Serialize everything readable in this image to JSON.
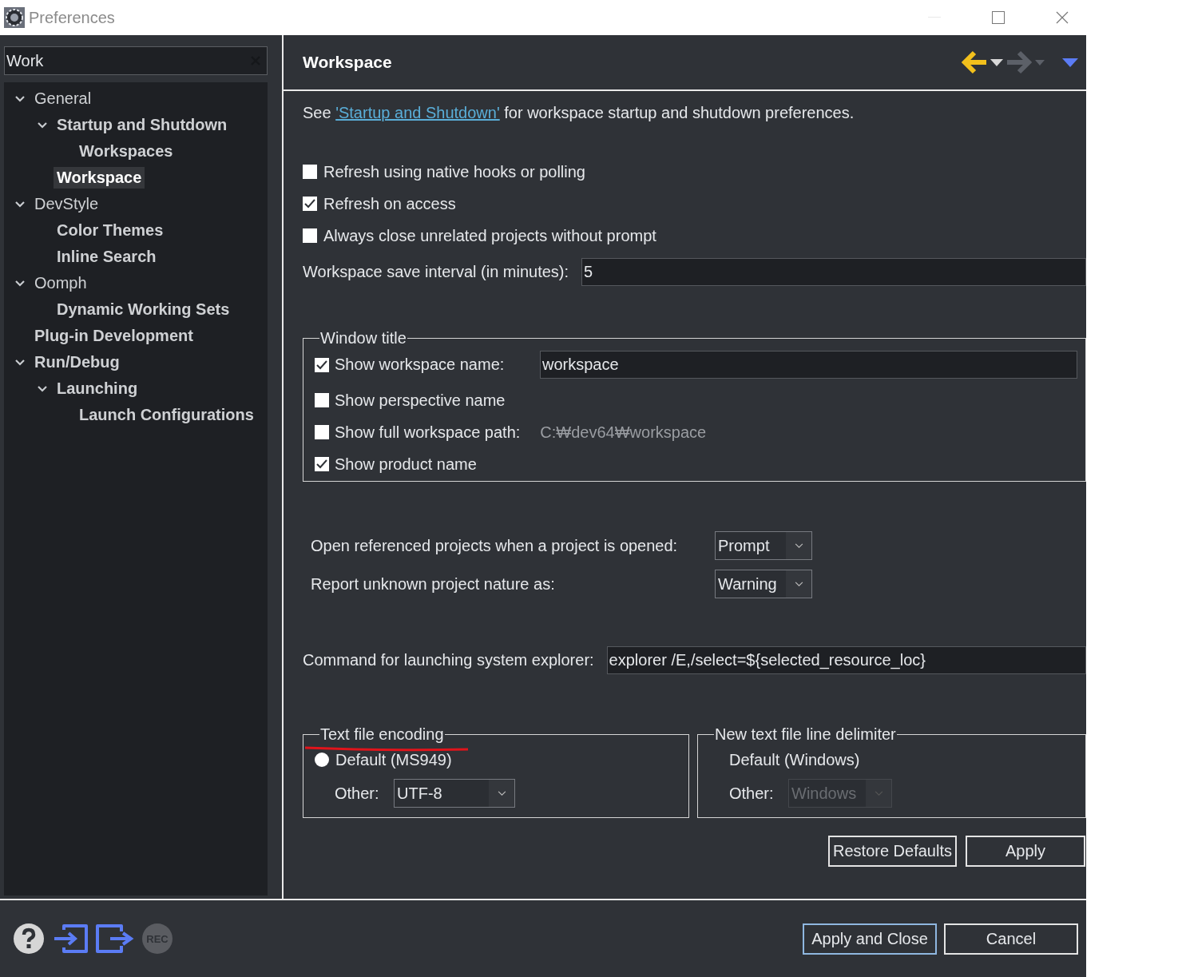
{
  "window": {
    "title": "Preferences"
  },
  "filter": {
    "value": "Work"
  },
  "tree": [
    {
      "label": "General",
      "match": false,
      "selected": false,
      "expanded": true,
      "children": [
        {
          "label": "Startup and Shutdown",
          "match": true,
          "selected": false,
          "expanded": true,
          "children": [
            {
              "label": "Workspaces",
              "match": true,
              "selected": false
            }
          ]
        },
        {
          "label": "Workspace",
          "match": true,
          "selected": true
        }
      ]
    },
    {
      "label": "DevStyle",
      "match": false,
      "selected": false,
      "expanded": true,
      "children": [
        {
          "label": "Color Themes",
          "match": true,
          "selected": false
        },
        {
          "label": "Inline Search",
          "match": true,
          "selected": false
        }
      ]
    },
    {
      "label": "Oomph",
      "match": false,
      "selected": false,
      "expanded": true,
      "children": [
        {
          "label": "Dynamic Working Sets",
          "match": true,
          "selected": false
        }
      ]
    },
    {
      "label": "Plug-in Development",
      "match": true,
      "selected": false
    },
    {
      "label": "Run/Debug",
      "match": true,
      "selected": false,
      "expanded": true,
      "children": [
        {
          "label": "Launching",
          "match": true,
          "selected": false,
          "expanded": true,
          "children": [
            {
              "label": "Launch Configurations",
              "match": true,
              "selected": false
            }
          ]
        }
      ]
    }
  ],
  "page": {
    "title": "Workspace",
    "nav": {
      "back_enabled": true,
      "forward_enabled": false
    },
    "intro": {
      "before": "See ",
      "link": "'Startup and Shutdown'",
      "after": " for workspace startup and shutdown preferences."
    },
    "options": [
      {
        "kind": "checkbox",
        "label": "Refresh using native hooks or polling",
        "checked": false
      },
      {
        "kind": "checkbox",
        "label": "Refresh on access",
        "checked": true
      },
      {
        "kind": "checkbox",
        "label": "Always close unrelated projects without prompt",
        "checked": false
      },
      {
        "kind": "field",
        "label": "Workspace save interval (in minutes):",
        "value": "5"
      }
    ],
    "window_title": {
      "title": "Window title",
      "rows": [
        {
          "kind": "field",
          "label": "Show workspace name:",
          "checked": true,
          "value": "workspace"
        },
        {
          "kind": "plain",
          "label": "Show perspective name",
          "checked": false
        },
        {
          "kind": "note",
          "label": "Show full workspace path:",
          "checked": false,
          "value": "C:₩dev64₩workspace"
        },
        {
          "kind": "plain",
          "label": "Show product name",
          "checked": true
        }
      ]
    },
    "combos": [
      {
        "label": "Open referenced projects when a project is opened:",
        "value": "Prompt"
      },
      {
        "label": "Report unknown project nature as:",
        "value": "Warning"
      }
    ],
    "explorer": {
      "label": "Command for launching system explorer:",
      "value": "explorer /E,/select=${selected_resource_loc}"
    },
    "encoding": {
      "title": "Text file encoding",
      "default": {
        "label": "Default (MS949)",
        "selected": false
      },
      "other": {
        "label": "Other:",
        "value": "UTF-8",
        "disabled": false
      }
    },
    "delimiter": {
      "title": "New text file line delimiter",
      "default": {
        "label": "Default (Windows)"
      },
      "other": {
        "label": "Other:",
        "value": "Windows",
        "disabled": true
      }
    },
    "buttons": [
      {
        "label": "Restore Defaults"
      },
      {
        "label": "Apply"
      }
    ]
  },
  "footer": {
    "rec_label": "REC",
    "buttons": [
      {
        "label": "Apply and Close",
        "default": true
      },
      {
        "label": "Cancel",
        "default": false
      }
    ]
  }
}
